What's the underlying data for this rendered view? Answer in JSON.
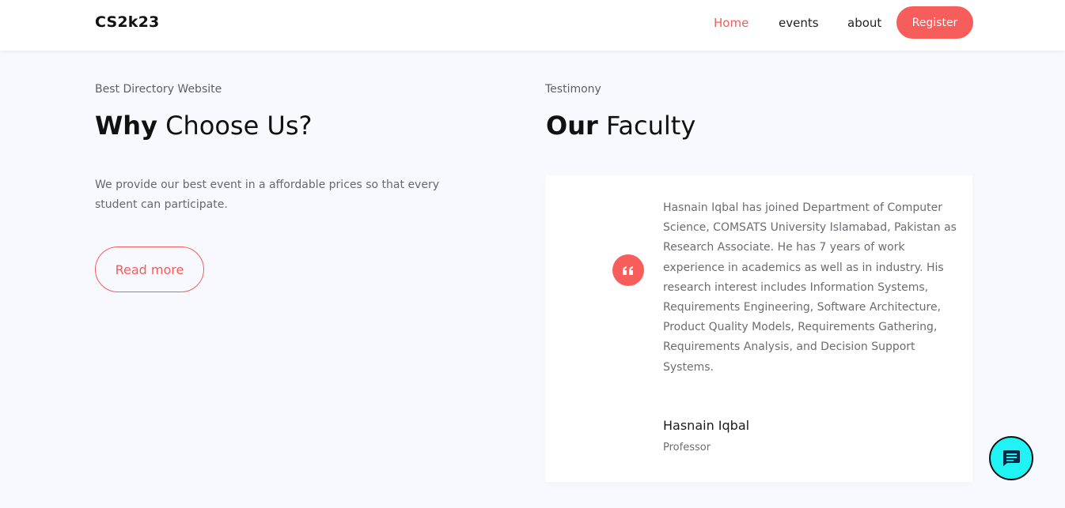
{
  "navbar": {
    "brand": "CS2k23",
    "links": [
      {
        "label": "Home",
        "active": true
      },
      {
        "label": "events",
        "active": false
      },
      {
        "label": "about",
        "active": false
      }
    ],
    "register_label": "Register"
  },
  "why_section": {
    "eyebrow": "Best Directory Website",
    "heading_bold": "Why",
    "heading_rest": " Choose Us?",
    "description": "We provide our best event in a affordable prices so that every student can participate.",
    "read_more_label": "Read more"
  },
  "faculty_section": {
    "eyebrow": "Testimony",
    "heading_bold": "Our",
    "heading_rest": " Faculty",
    "testimonial": {
      "quote": "Hasnain Iqbal has joined Department of Computer Science, COMSATS University Islamabad, Pakistan as Research Associate. He has 7 years of work experience in academics as well as in industry. His research interest includes Information Systems, Requirements Engineering, Software Architecture, Product Quality Models, Requirements Gathering, Requirements Analysis, and Decision Support Systems.",
      "name": "Hasnain Iqbal",
      "title": "Professor",
      "quote_icon": "quote-icon"
    }
  },
  "chat_widget": {
    "icon": "chat-message-icon"
  },
  "colors": {
    "accent": "#f75d5b",
    "page_bg": "#f8f9fe",
    "chat_bg": "#1ff3f3"
  }
}
